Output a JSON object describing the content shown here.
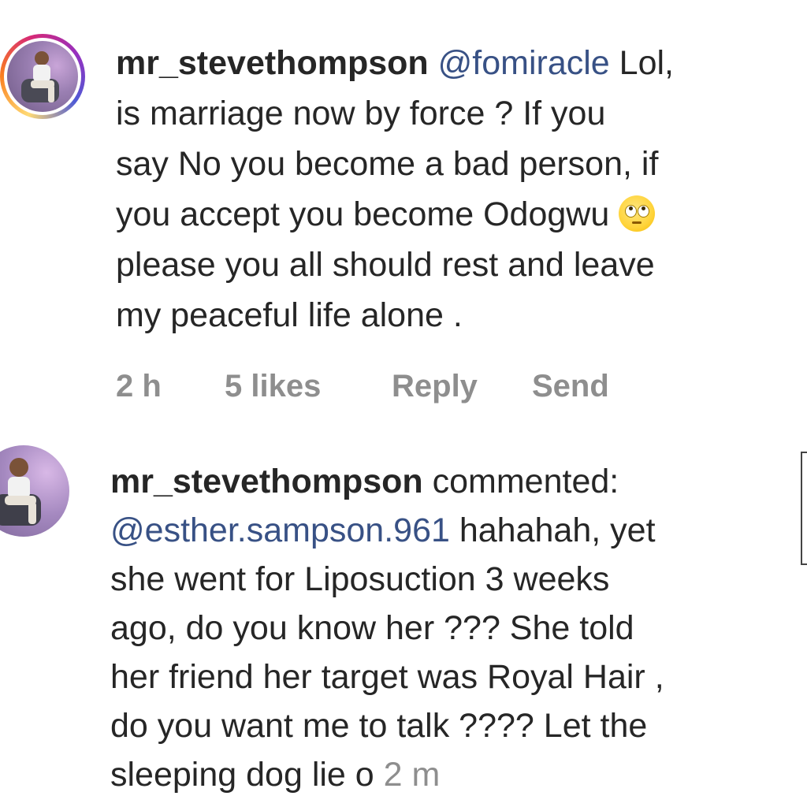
{
  "comments": [
    {
      "username": "mr_stevethompson",
      "mention": "@fomiracle",
      "lines": [
        " Lol,",
        "is marriage now by force ? If you",
        "say No you become a bad person,  if",
        "you accept you become Odogwu ",
        "please you all should rest and leave",
        "my peaceful life alone ."
      ],
      "emoji": "eye-roll-emoji",
      "time": "2 h",
      "likes": "5 likes",
      "reply_label": "Reply",
      "send_label": "Send"
    },
    {
      "username": "mr_stevethompson",
      "verb": " commented:",
      "mention": "@esther.sampson.961",
      "lines": [
        " hahahah, yet",
        "she went for Liposuction 3 weeks",
        "ago, do you know her ??? She told",
        "her friend her target was Royal Hair ,",
        "do you want me to talk ???? Let the",
        "sleeping dog lie o "
      ],
      "time": "2 m"
    }
  ],
  "colors": {
    "text": "#262626",
    "mention": "#385185",
    "muted": "#8e8e8e",
    "story_ring": [
      "#feda75",
      "#fa7e1e",
      "#d62976",
      "#962fbf",
      "#4f5bd5"
    ]
  }
}
